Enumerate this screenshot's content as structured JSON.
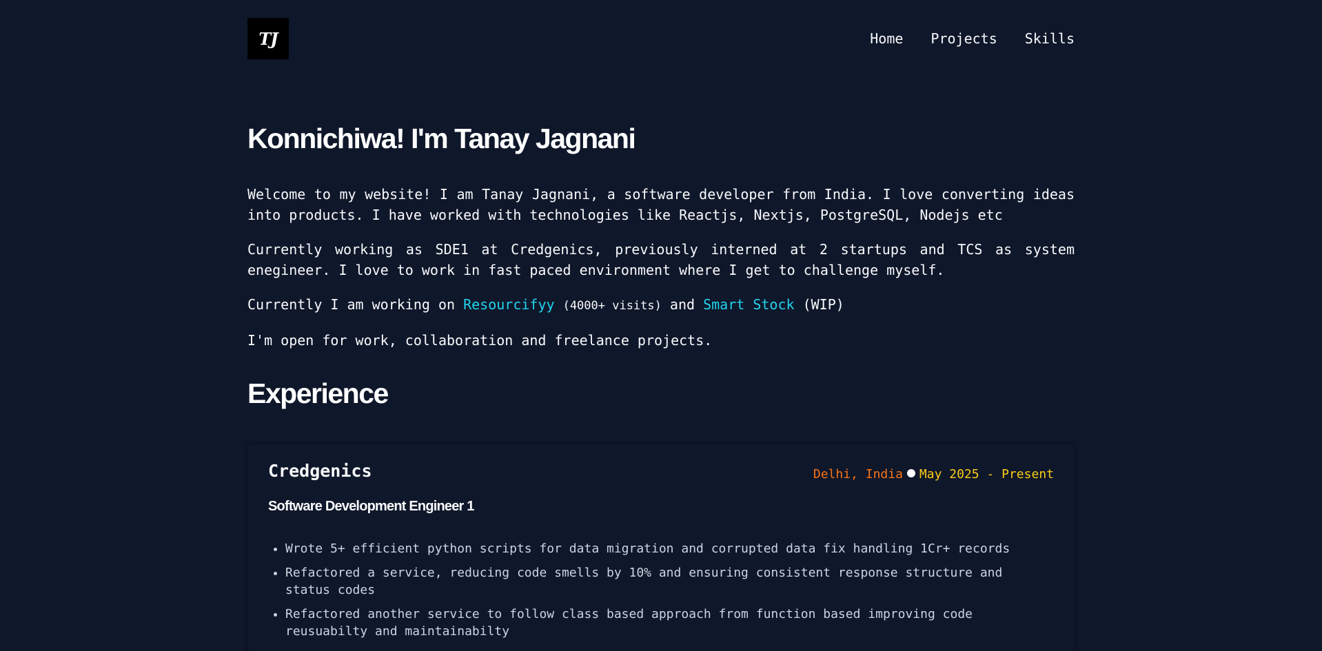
{
  "header": {
    "logo_text": "TJ",
    "nav": [
      "Home",
      "Projects",
      "Skills"
    ]
  },
  "hero": {
    "title": "Konnichiwa! I'm Tanay Jagnani",
    "para1": "Welcome to my website! I am Tanay Jagnani, a software developer from India. I love converting ideas into products. I have worked with technologies like Reactjs, Nextjs, PostgreSQL, Nodejs etc",
    "para2": "Currently working as SDE1 at Credgenics, previously interned at 2 startups and TCS as system enegineer. I love to work in fast paced environment where I get to challenge myself.",
    "para3": {
      "prefix": "Currently I am working on ",
      "link1": "Resourcifyy",
      "visits": "(4000+ visits)",
      "and": " and ",
      "link2": "Smart Stock",
      "suffix": " (WIP)"
    },
    "para4": "I'm open for work, collaboration and freelance projects."
  },
  "experience": {
    "heading": "Experience",
    "items": [
      {
        "company": "Credgenics",
        "location": "Delhi, India",
        "dates": "May 2025 - Present",
        "role": "Software Development Engineer 1",
        "points": [
          "Wrote 5+ efficient python scripts for data migration and corrupted data fix handling 1Cr+ records",
          "Refactored a service, reducing code smells by 10% and ensuring consistent response structure and status codes",
          "Refactored another service to follow class based approach from function based improving code reusuabilty and maintainabilty"
        ]
      }
    ]
  },
  "colors": {
    "background": "#0f172a",
    "link": "#22d3ee",
    "location": "#f97316",
    "date": "#facc15"
  }
}
